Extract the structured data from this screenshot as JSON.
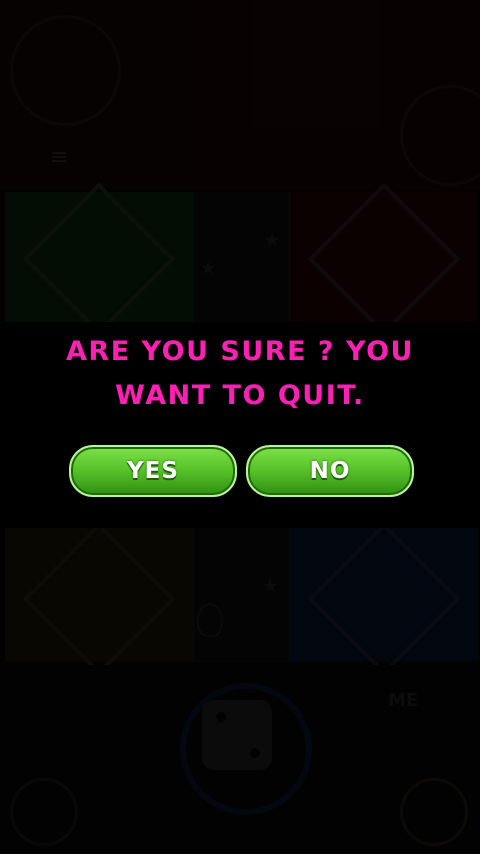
{
  "dialog": {
    "message_line1": "ARE YOU SURE ? YOU",
    "message_line2": "WANT TO QUIT.",
    "yes_label": "YES",
    "no_label": "NO"
  },
  "background": {
    "player_top_label": "≡",
    "player_bottom_label": "ME"
  },
  "colors": {
    "message": "#ff1fb4",
    "button_green": "#59c52a",
    "board_green": "#1f6b1f",
    "board_red": "#7a1414",
    "board_yellow": "#6b5a10",
    "board_blue": "#102a6b"
  },
  "icons": [
    "dice-icon",
    "star-icon",
    "token-icon",
    "avatar-icon"
  ]
}
